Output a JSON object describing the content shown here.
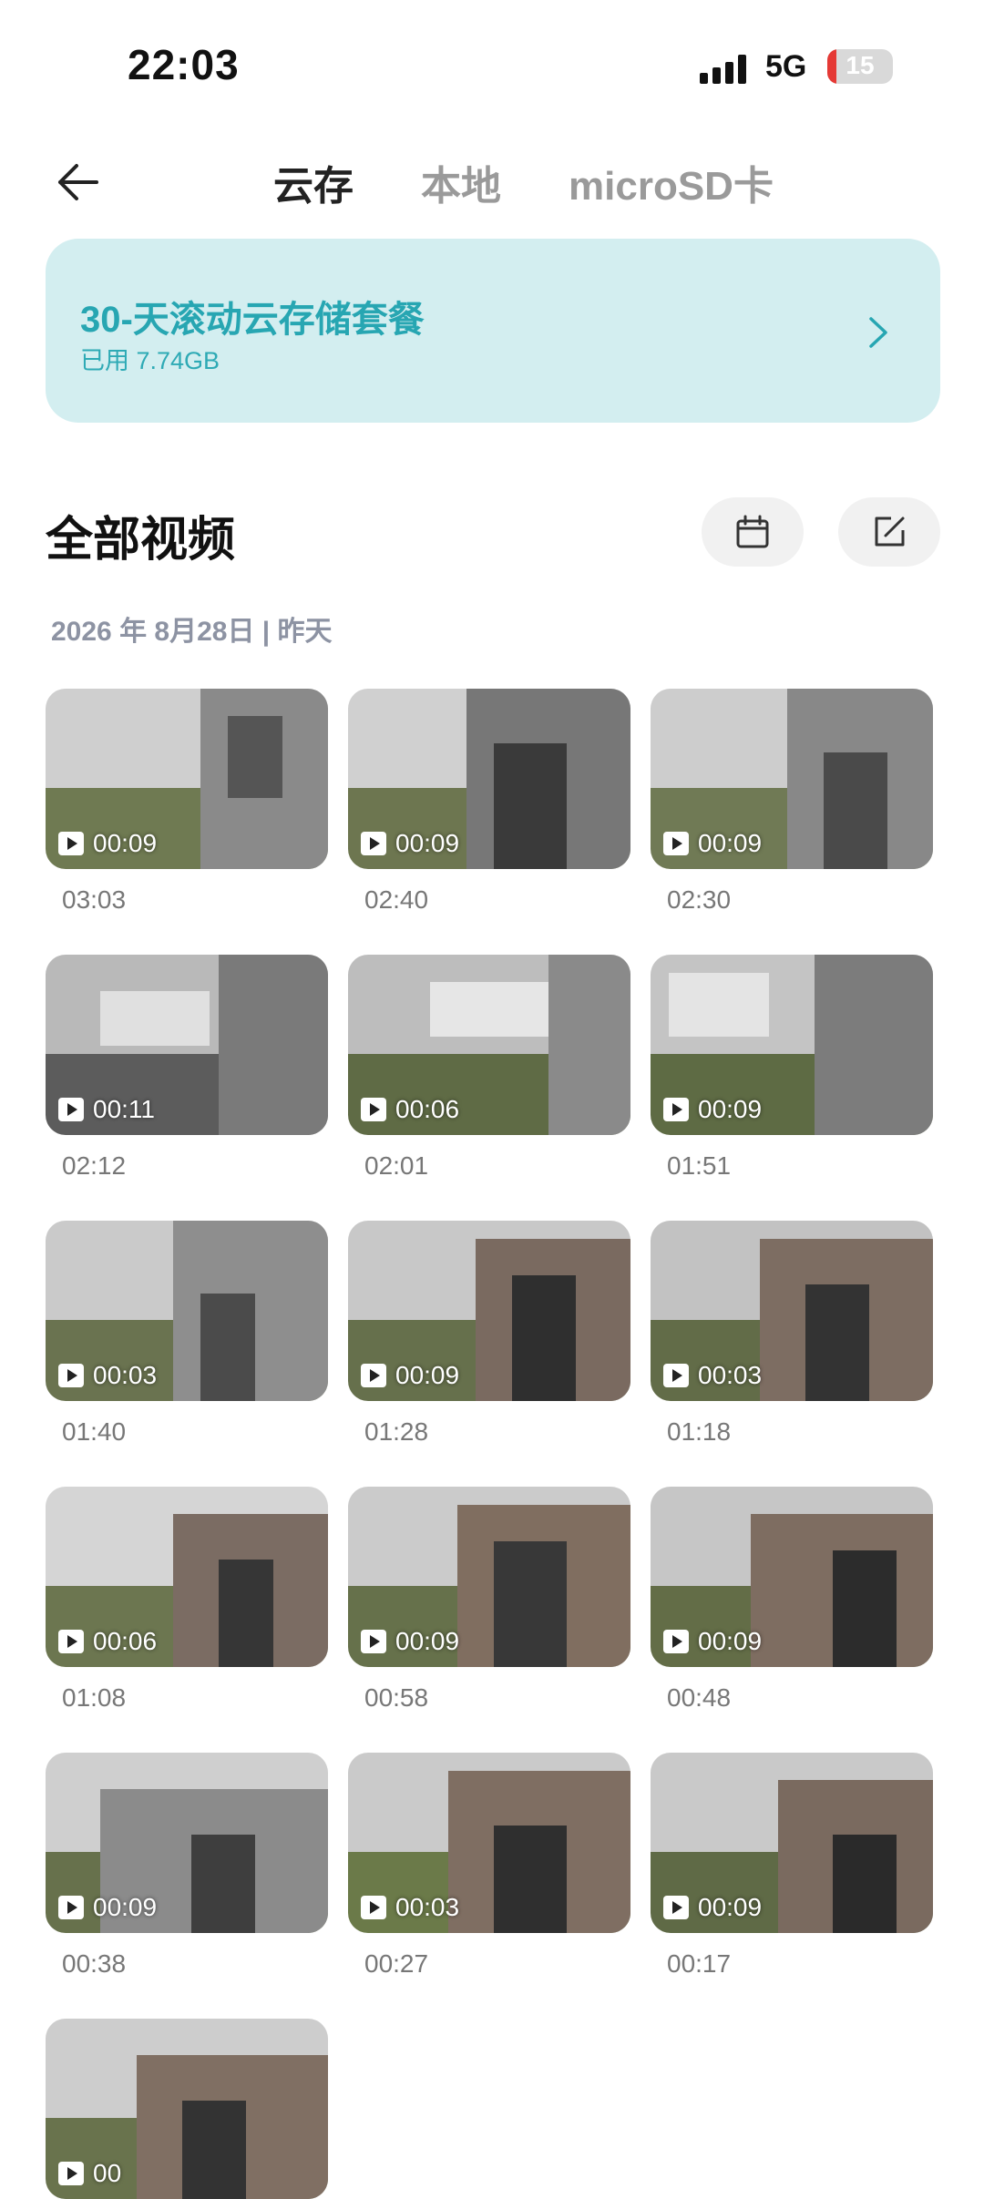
{
  "status": {
    "time": "22:03",
    "network": "5G",
    "battery": "15"
  },
  "header": {
    "tabs": [
      {
        "label": "云存",
        "active": true
      },
      {
        "label": "本地",
        "active": false
      },
      {
        "label": "microSD卡",
        "active": false
      }
    ]
  },
  "banner": {
    "title": "30-天滚动云存储套餐",
    "usage": "已用 7.74GB"
  },
  "section": {
    "title": "全部视频",
    "date": "2026 年 8月28日 | 昨天"
  },
  "clips": [
    {
      "duration": "00:09",
      "time": "03:03"
    },
    {
      "duration": "00:09",
      "time": "02:40"
    },
    {
      "duration": "00:09",
      "time": "02:30"
    },
    {
      "duration": "00:11",
      "time": "02:12"
    },
    {
      "duration": "00:06",
      "time": "02:01"
    },
    {
      "duration": "00:09",
      "time": "01:51"
    },
    {
      "duration": "00:03",
      "time": "01:40"
    },
    {
      "duration": "00:09",
      "time": "01:28"
    },
    {
      "duration": "00:03",
      "time": "01:18"
    },
    {
      "duration": "00:06",
      "time": "01:08"
    },
    {
      "duration": "00:09",
      "time": "00:58"
    },
    {
      "duration": "00:09",
      "time": "00:48"
    },
    {
      "duration": "00:09",
      "time": "00:38"
    },
    {
      "duration": "00:03",
      "time": "00:27"
    },
    {
      "duration": "00:09",
      "time": "00:17"
    },
    {
      "duration": "00",
      "time": ""
    }
  ],
  "colors": {
    "accent": "#27a6b2",
    "banner_bg": "#d3eef0",
    "date_label": "#8d93a3"
  }
}
